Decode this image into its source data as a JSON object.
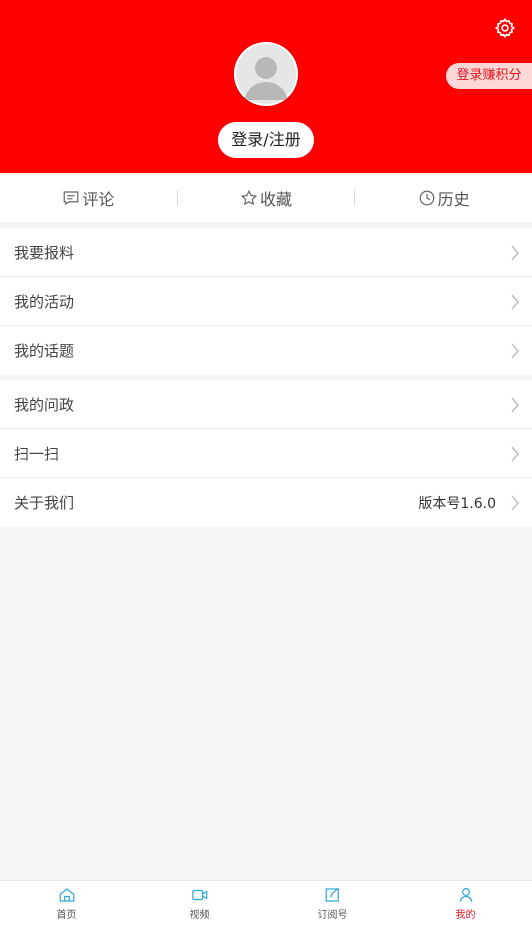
{
  "header": {
    "bg_color": "#ff0000",
    "settings_icon": "gear-icon",
    "avatar_icon": "default-avatar",
    "earn_badge": "登录赚积分",
    "login_label": "登录/注册"
  },
  "quick_tabs": [
    {
      "icon": "comment-icon",
      "label": "评论"
    },
    {
      "icon": "star-icon",
      "label": "收藏"
    },
    {
      "icon": "clock-icon",
      "label": "历史"
    }
  ],
  "menu_group_1": [
    {
      "label": "我要报料"
    },
    {
      "label": "我的活动"
    },
    {
      "label": "我的话题"
    }
  ],
  "menu_group_2": [
    {
      "label": "我的问政"
    },
    {
      "label": "扫一扫"
    },
    {
      "label": "关于我们",
      "value": "版本号1.6.0"
    }
  ],
  "bottom_nav": [
    {
      "icon": "home-icon",
      "label": "首页"
    },
    {
      "icon": "video-icon",
      "label": "视频"
    },
    {
      "icon": "edit-icon",
      "label": "订阅号"
    },
    {
      "icon": "user-icon",
      "label": "我的",
      "active": true
    }
  ],
  "colors": {
    "accent": "#e0161c",
    "nav_icon": "#2aa6d8"
  }
}
